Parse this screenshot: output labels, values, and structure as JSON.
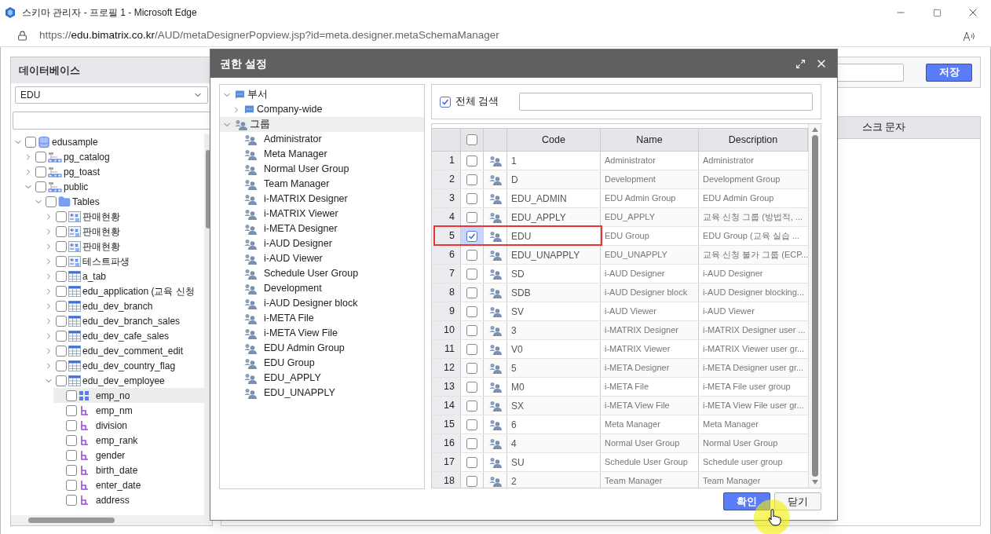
{
  "window": {
    "title": "스키마 관리자 - 프로필 1 - Microsoft Edge"
  },
  "address_bar": {
    "scheme": "https://",
    "host": "edu.bimatrix.co.kr",
    "path": "/AUD/metaDesignerPopview.jsp?id=meta.designer.metaSchemaManager"
  },
  "left_panel": {
    "title": "데이터베이스",
    "database_select": "EDU",
    "tree": [
      {
        "label": "edusample",
        "kind": "database",
        "checked": false,
        "expanded": true,
        "children": [
          {
            "label": "pg_catalog",
            "kind": "schema",
            "checked": false,
            "expanded": false
          },
          {
            "label": "pg_toast",
            "kind": "schema",
            "checked": false,
            "expanded": false
          },
          {
            "label": "public",
            "kind": "schema",
            "checked": false,
            "expanded": true,
            "children": [
              {
                "label": "Tables",
                "kind": "folder",
                "checked": false,
                "expanded": true,
                "children": [
                  {
                    "label": "판매현황",
                    "kind": "view",
                    "checked": false,
                    "expanded": false
                  },
                  {
                    "label": "판매현황",
                    "kind": "view",
                    "checked": false,
                    "expanded": false
                  },
                  {
                    "label": "판매현황",
                    "kind": "view",
                    "checked": false,
                    "expanded": false
                  },
                  {
                    "label": "테스트파생",
                    "kind": "view",
                    "checked": false,
                    "expanded": false
                  },
                  {
                    "label": "a_tab",
                    "kind": "table",
                    "checked": false,
                    "expanded": false
                  },
                  {
                    "label": "edu_application (교육 신청",
                    "kind": "table",
                    "checked": false,
                    "expanded": false
                  },
                  {
                    "label": "edu_dev_branch",
                    "kind": "table",
                    "checked": false,
                    "expanded": false
                  },
                  {
                    "label": "edu_dev_branch_sales",
                    "kind": "table",
                    "checked": false,
                    "expanded": false
                  },
                  {
                    "label": "edu_dev_cafe_sales",
                    "kind": "table",
                    "checked": false,
                    "expanded": false
                  },
                  {
                    "label": "edu_dev_comment_edit",
                    "kind": "table",
                    "checked": false,
                    "expanded": false
                  },
                  {
                    "label": "edu_dev_country_flag",
                    "kind": "table",
                    "checked": false,
                    "expanded": false
                  },
                  {
                    "label": "edu_dev_employee",
                    "kind": "table",
                    "checked": false,
                    "expanded": true,
                    "children": [
                      {
                        "label": "emp_no",
                        "kind": "number",
                        "checked": false,
                        "selected": true
                      },
                      {
                        "label": "emp_nm",
                        "kind": "text",
                        "checked": false,
                        "selected": false
                      },
                      {
                        "label": "division",
                        "kind": "text",
                        "checked": false,
                        "selected": false
                      },
                      {
                        "label": "emp_rank",
                        "kind": "text",
                        "checked": false,
                        "selected": false
                      },
                      {
                        "label": "gender",
                        "kind": "text",
                        "checked": false,
                        "selected": false
                      },
                      {
                        "label": "birth_date",
                        "kind": "text",
                        "checked": false,
                        "selected": false
                      },
                      {
                        "label": "enter_date",
                        "kind": "text",
                        "checked": false,
                        "selected": false
                      },
                      {
                        "label": "address",
                        "kind": "text",
                        "checked": false,
                        "selected": false
                      }
                    ]
                  }
                ]
              }
            ]
          }
        ]
      }
    ]
  },
  "background": {
    "save_button": "저장",
    "column_header": "스크 문자"
  },
  "dialog": {
    "title": "권한 설정",
    "tree": [
      {
        "label": "부서",
        "kind": "department",
        "expanded": true,
        "selected": false,
        "children": [
          {
            "label": "Company-wide",
            "kind": "department",
            "expanded": false,
            "selected": false
          }
        ]
      },
      {
        "label": "그룹",
        "kind": "group",
        "expanded": true,
        "selected": true,
        "children": [
          {
            "label": "Administrator",
            "kind": "group",
            "selected": false
          },
          {
            "label": "Meta Manager",
            "kind": "group",
            "selected": false
          },
          {
            "label": "Normal User Group",
            "kind": "group",
            "selected": false
          },
          {
            "label": "Team Manager",
            "kind": "group",
            "selected": false
          },
          {
            "label": "i-MATRIX Designer",
            "kind": "group",
            "selected": false
          },
          {
            "label": "i-MATRIX Viewer",
            "kind": "group",
            "selected": false
          },
          {
            "label": "i-META Designer",
            "kind": "group",
            "selected": false
          },
          {
            "label": "i-AUD Designer",
            "kind": "group",
            "selected": false
          },
          {
            "label": "i-AUD Viewer",
            "kind": "group",
            "selected": false
          },
          {
            "label": "Schedule User Group",
            "kind": "group",
            "selected": false
          },
          {
            "label": "Development",
            "kind": "group",
            "selected": false
          },
          {
            "label": "i-AUD Designer block",
            "kind": "group",
            "selected": false
          },
          {
            "label": "i-META File",
            "kind": "group",
            "selected": false
          },
          {
            "label": "i-META View File",
            "kind": "group",
            "selected": false
          },
          {
            "label": "EDU Admin Group",
            "kind": "group",
            "selected": false
          },
          {
            "label": "EDU Group",
            "kind": "group",
            "selected": false
          },
          {
            "label": "EDU_APPLY",
            "kind": "group",
            "selected": false
          },
          {
            "label": "EDU_UNAPPLY",
            "kind": "group",
            "selected": false
          }
        ]
      }
    ],
    "search_all": {
      "label": "전체 검색",
      "checked": true
    },
    "table": {
      "header_checked": false,
      "columns": [
        "Code",
        "Name",
        "Description"
      ],
      "rows": [
        {
          "no": "1",
          "checked": false,
          "code": "1",
          "name": "Administrator",
          "description": "Administrator"
        },
        {
          "no": "2",
          "checked": false,
          "code": "D",
          "name": "Development",
          "description": "Development Group"
        },
        {
          "no": "3",
          "checked": false,
          "code": "EDU_ADMIN",
          "name": "EDU Admin Group",
          "description": "EDU Admin Group"
        },
        {
          "no": "4",
          "checked": false,
          "code": "EDU_APPLY",
          "name": "EDU_APPLY",
          "description": "교육 신청 그룹 (방법적, ..."
        },
        {
          "no": "5",
          "checked": true,
          "code": "EDU",
          "name": "EDU Group",
          "description": "EDU Group (교육 실습 ..."
        },
        {
          "no": "6",
          "checked": false,
          "code": "EDU_UNAPPLY",
          "name": "EDU_UNAPPLY",
          "description": "교육 신청 불가 그룹 (ECP..."
        },
        {
          "no": "7",
          "checked": false,
          "code": "SD",
          "name": "i-AUD Designer",
          "description": "i-AUD Designer"
        },
        {
          "no": "8",
          "checked": false,
          "code": "SDB",
          "name": "i-AUD Designer block",
          "description": "i-AUD Designer blocking..."
        },
        {
          "no": "9",
          "checked": false,
          "code": "SV",
          "name": "i-AUD Viewer",
          "description": "i-AUD Viewer"
        },
        {
          "no": "10",
          "checked": false,
          "code": "3",
          "name": "i-MATRIX Designer",
          "description": "i-MATRIX Designer user ..."
        },
        {
          "no": "11",
          "checked": false,
          "code": "V0",
          "name": "i-MATRIX Viewer",
          "description": "i-MATRIX Viewer user gr..."
        },
        {
          "no": "12",
          "checked": false,
          "code": "5",
          "name": "i-META Designer",
          "description": "i-META Designer user gr..."
        },
        {
          "no": "13",
          "checked": false,
          "code": "M0",
          "name": "i-META File",
          "description": "i-META File user group"
        },
        {
          "no": "14",
          "checked": false,
          "code": "SX",
          "name": "i-META View File",
          "description": "i-META View File user gr..."
        },
        {
          "no": "15",
          "checked": false,
          "code": "6",
          "name": "Meta Manager",
          "description": "Meta Manager"
        },
        {
          "no": "16",
          "checked": false,
          "code": "4",
          "name": "Normal User Group",
          "description": "Normal User Group"
        },
        {
          "no": "17",
          "checked": false,
          "code": "SU",
          "name": "Schedule User Group",
          "description": "Schedule user group"
        },
        {
          "no": "18",
          "checked": false,
          "code": "2",
          "name": "Team Manager",
          "description": "Team Manager"
        }
      ]
    },
    "buttons": [
      {
        "label": "확인",
        "kind": "primary"
      },
      {
        "label": "닫기",
        "kind": "secondary"
      }
    ]
  }
}
